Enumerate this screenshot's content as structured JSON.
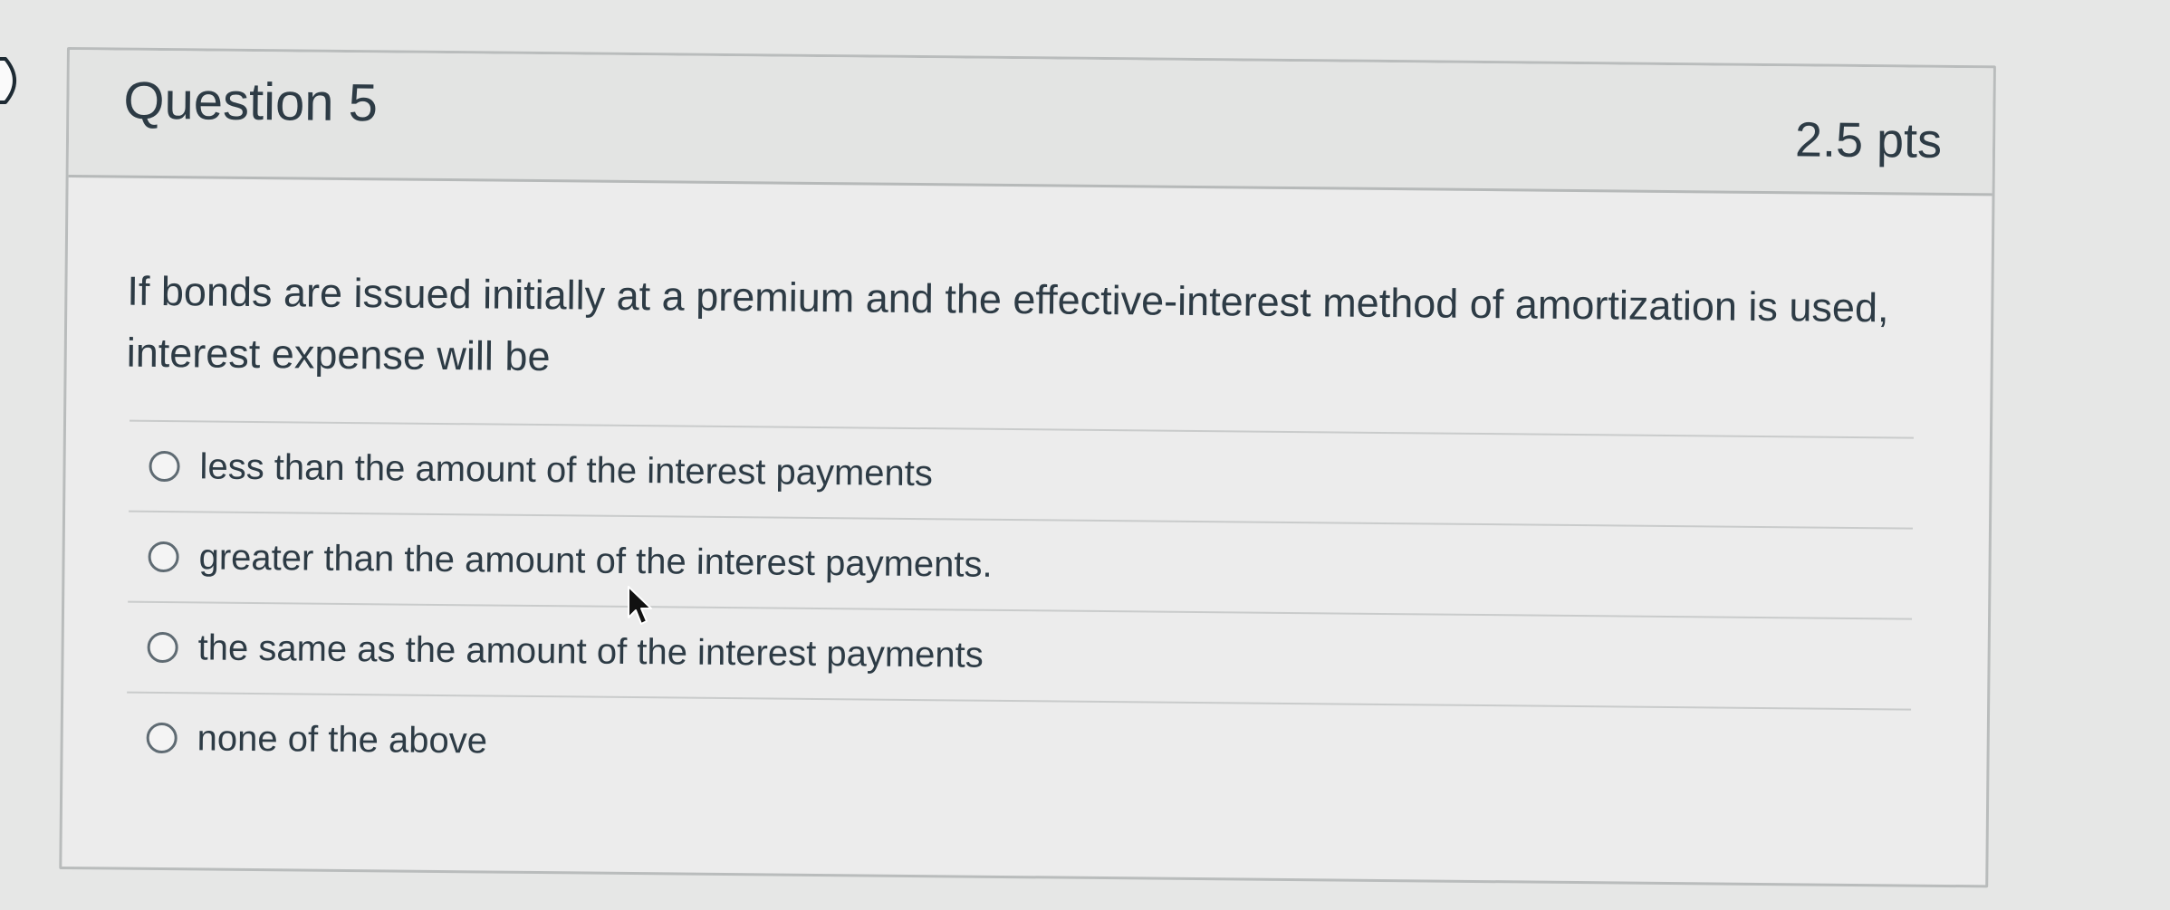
{
  "question": {
    "title": "Question 5",
    "points": "2.5 pts",
    "text": "If bonds are issued initially at a premium and the effective-interest method of amortization is used, interest expense will be"
  },
  "answers": [
    {
      "label": "less than the amount of the interest payments",
      "selected": false
    },
    {
      "label": "greater than the amount of the interest payments.",
      "selected": false
    },
    {
      "label": "the same as the amount of the interest payments",
      "selected": false
    },
    {
      "label": "none of the above",
      "selected": false
    }
  ],
  "icons": {
    "flag": "bookmark-flag-icon",
    "radio": "radio-unchecked-icon",
    "cursor": "mouse-pointer-icon"
  },
  "colors": {
    "text": "#2d3b45",
    "header_background": "#e3e4e3",
    "border": "#b9bcbc",
    "page_background": "#e6e7e6"
  }
}
